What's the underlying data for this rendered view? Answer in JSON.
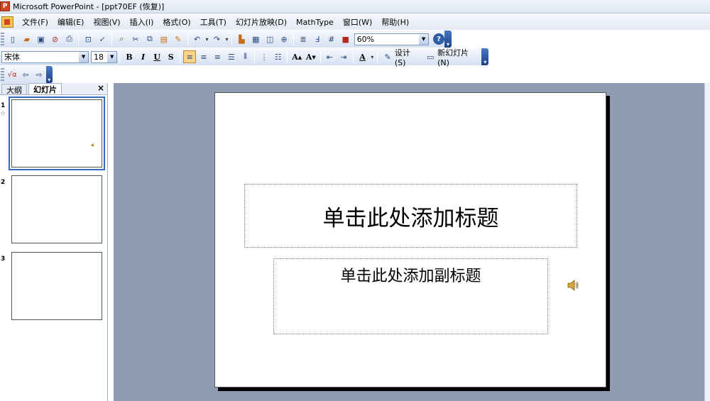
{
  "titlebar": {
    "title": "Microsoft PowerPoint - [ppt70EF  (恢复)]"
  },
  "menu": {
    "items": [
      "文件(F)",
      "编辑(E)",
      "视图(V)",
      "插入(I)",
      "格式(O)",
      "工具(T)",
      "幻灯片放映(D)",
      "MathType",
      "窗口(W)",
      "帮助(H)"
    ]
  },
  "toolbar_standard": {
    "zoom_value": "60%",
    "icons": [
      "new-icon",
      "open-icon",
      "save-icon",
      "permission-icon",
      "print-icon",
      "print-preview-icon",
      "spelling-icon",
      "research-icon",
      "cut-icon",
      "copy-icon",
      "paste-icon",
      "format-painter-icon",
      "undo-icon",
      "redo-icon",
      "insert-chart-icon",
      "insert-table-icon",
      "tables-borders-icon",
      "hyperlink-icon",
      "expand-all-icon",
      "show-formatting-icon",
      "grid-icon",
      "color-grayscale-icon",
      "help-icon"
    ]
  },
  "toolbar_formatting": {
    "font_name": "宋体",
    "font_size": "18",
    "bold_label": "B",
    "italic_label": "I",
    "underline_label": "U",
    "shadow_label": "S",
    "design_label": "设计(S)",
    "new_slide_label": "新幻灯片(N)"
  },
  "toolbar_mathtype": {
    "icons": [
      "mathtype-insert-icon",
      "arrow-left-icon",
      "arrow-right-icon"
    ]
  },
  "left_pane": {
    "tabs": [
      "大纲",
      "幻灯片"
    ],
    "active_tab": "幻灯片",
    "thumbnails": [
      {
        "number": "1",
        "selected": true,
        "has_animation_star": true
      },
      {
        "number": "2",
        "selected": false,
        "has_animation_star": false
      },
      {
        "number": "3",
        "selected": false,
        "has_animation_star": false
      }
    ]
  },
  "slide": {
    "title_placeholder": "单击此处添加标题",
    "subtitle_placeholder": "单击此处添加副标题",
    "has_sound_icon": true
  },
  "colors": {
    "workspace_bg": "#8f9bb0",
    "selection_outline": "#316ac5",
    "active_align_btn": "#f8d58a"
  }
}
